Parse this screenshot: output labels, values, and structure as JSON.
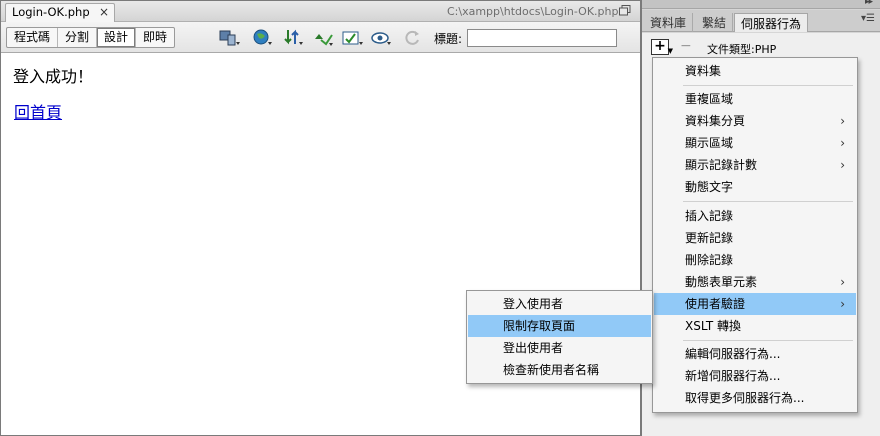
{
  "document": {
    "tab_label": "Login-OK.php",
    "close_glyph": "×",
    "file_path": "C:\\xampp\\htdocs\\Login-OK.php"
  },
  "toolbar": {
    "views": [
      {
        "label": "程式碼",
        "active": false
      },
      {
        "label": "分割",
        "active": false
      },
      {
        "label": "設計",
        "active": true
      },
      {
        "label": "即時",
        "active": false
      }
    ],
    "icons": [
      "multiscreen-icon",
      "preview-browser-icon",
      "file-management-icon",
      "w3c-validation-icon",
      "check-browser-compat-icon",
      "visual-aids-icon",
      "refresh-icon"
    ],
    "title_label": "標題:",
    "title_value": ""
  },
  "design_view": {
    "success_text": "登入成功！",
    "home_link": "回首頁"
  },
  "panel": {
    "tabs": [
      {
        "label": "資料庫",
        "active": false
      },
      {
        "label": "繫結",
        "active": false
      },
      {
        "label": "伺服器行為",
        "active": true
      }
    ],
    "add_symbol": "+",
    "remove_symbol": "−",
    "doctype_label": "文件類型:PHP"
  },
  "main_menu": {
    "items": [
      {
        "label": "資料集",
        "submenu": false
      },
      {
        "label": "重複區域",
        "submenu": false,
        "separator_before": true
      },
      {
        "label": "資料集分頁",
        "submenu": true
      },
      {
        "label": "顯示區域",
        "submenu": true
      },
      {
        "label": "顯示記錄計數",
        "submenu": true
      },
      {
        "label": "動態文字",
        "submenu": false
      },
      {
        "label": "插入記錄",
        "submenu": false,
        "separator_before": true
      },
      {
        "label": "更新記錄",
        "submenu": false
      },
      {
        "label": "刪除記錄",
        "submenu": false
      },
      {
        "label": "動態表單元素",
        "submenu": true
      },
      {
        "label": "使用者驗證",
        "submenu": true,
        "highlighted": true
      },
      {
        "label": "XSLT 轉換",
        "submenu": false
      },
      {
        "label": "編輯伺服器行為...",
        "submenu": false,
        "separator_before": true
      },
      {
        "label": "新增伺服器行為...",
        "submenu": false
      },
      {
        "label": "取得更多伺服器行為...",
        "submenu": false
      }
    ]
  },
  "sub_menu": {
    "items": [
      {
        "label": "登入使用者"
      },
      {
        "label": "限制存取頁面",
        "highlighted": true
      },
      {
        "label": "登出使用者"
      },
      {
        "label": "檢查新使用者名稱"
      }
    ]
  },
  "colors": {
    "highlight": "#91c9f7",
    "link": "#0000cc",
    "panel_bg": "#efefef"
  }
}
